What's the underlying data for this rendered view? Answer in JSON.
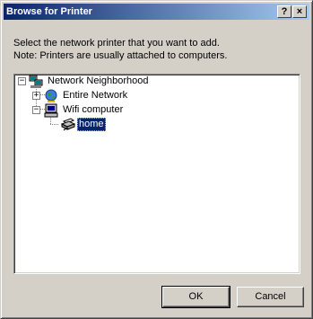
{
  "window": {
    "title": "Browse for Printer",
    "help_glyph": "?",
    "close_glyph": "×"
  },
  "instructions": {
    "line1": "Select the network printer that you want to add.",
    "line2": "Note: Printers are usually attached to computers."
  },
  "tree": {
    "nodes": [
      {
        "label": "Network Neighborhood",
        "expander": "−",
        "icon": "network-neighborhood-icon"
      },
      {
        "label": "Entire Network",
        "expander": "+",
        "icon": "globe-icon"
      },
      {
        "label": "Wifi computer",
        "expander": "−",
        "icon": "computer-icon"
      },
      {
        "label": "home",
        "expander": "",
        "icon": "printer-icon",
        "selected": true
      }
    ]
  },
  "buttons": {
    "ok": "OK",
    "cancel": "Cancel"
  }
}
